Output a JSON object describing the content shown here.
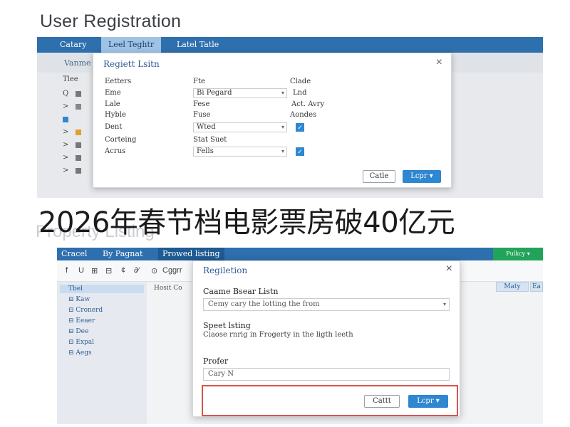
{
  "top": {
    "title": "User Registration",
    "tabs": [
      "Catary",
      "Leel Teghtr",
      "Latel Tatle"
    ],
    "subbar_label": "Vanme",
    "side_header": "Tlee",
    "side_rows": [
      "Q",
      ">",
      "",
      ">",
      ">",
      ">",
      ">"
    ],
    "modal": {
      "title": "Regiett Lsitn",
      "close": "×",
      "col_headers": [
        "Eetters",
        "Fte",
        "Clade"
      ],
      "rows": [
        {
          "label": "Eme",
          "select": "Bi Pegard",
          "value": "Lnd"
        },
        {
          "label": "Lale",
          "text": "Fese",
          "value": "Act. Avry"
        },
        {
          "label": "Hyble",
          "text": "Fuse",
          "value": "Aondes"
        },
        {
          "label": "Dent",
          "select": "Wted",
          "check": "✓"
        },
        {
          "label": "Corteing",
          "text": "Stat Suet"
        },
        {
          "label": "Acrus",
          "select": "Fells",
          "check": "✓"
        }
      ],
      "cancel_label": "Catle",
      "primary_label": "Lcpr ▾"
    }
  },
  "headline": "2026年春节档电影票房破40亿元",
  "ghost_title": "Property Listing",
  "bottom": {
    "tabs": [
      "Cracel",
      "By Pagnat",
      "Prowed listing"
    ],
    "status_label": "Pulkcy ▾",
    "toolbar": [
      "f",
      "U",
      "⊞",
      "⊟",
      "¢",
      "∂⁄",
      "⊙",
      "Cggrr"
    ],
    "side_header": "Tbel",
    "side_items": [
      "⊟ Kaw",
      "⊟ Cronerd",
      "⊟ Eeaer",
      "⊟ Dee",
      "⊟ Expal",
      "⊟ Aegs"
    ],
    "col_header": "Hosit Co",
    "right_buttons": [
      "Maty",
      "Ea"
    ],
    "modal": {
      "title": "Regiletion",
      "close": "×",
      "field1_label": "Caame Bsear Listn",
      "field1_value": "Cemy cary the lotting the from",
      "field2_label": "Speet lsting",
      "field2_desc": "Ciaose rnrig in Frogerty in the ligth leeth",
      "field3_label": "Profer",
      "field3_value": "Cary N",
      "cancel_label": "Cattt",
      "primary_label": "Lcpr ▾"
    }
  },
  "colors": {
    "nav_blue": "#2e6fad",
    "accent_blue": "#2f86d1",
    "status_green": "#22a35a",
    "highlight_red": "#d9534f"
  }
}
